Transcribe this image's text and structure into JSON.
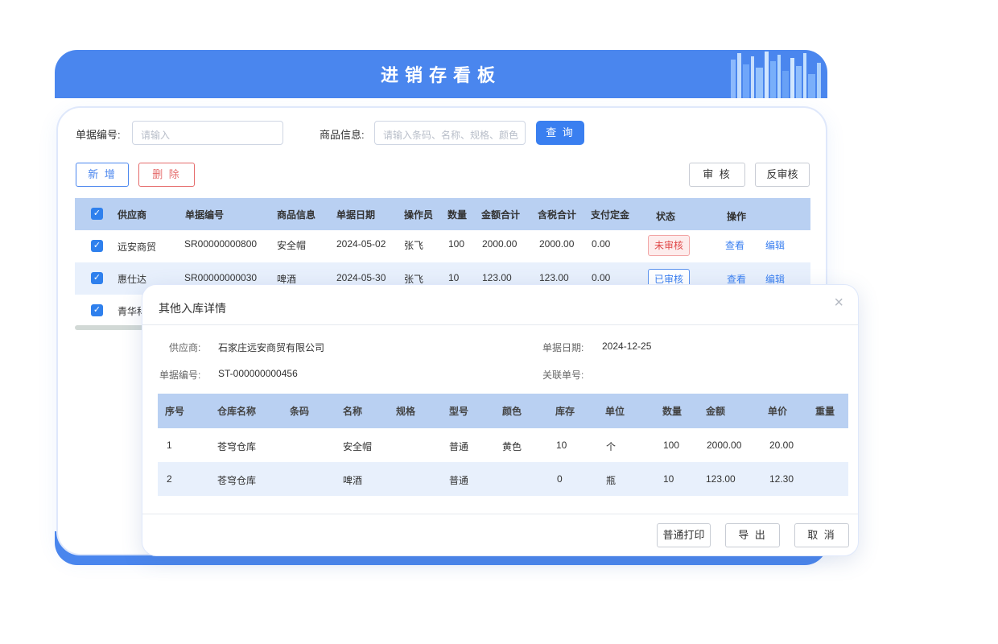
{
  "header": {
    "title": "进销存看板"
  },
  "search": {
    "doc_no_label": "单据编号:",
    "doc_no_placeholder": "请输入",
    "goods_label": "商品信息:",
    "goods_placeholder": "请输入条码、名称、规格、颜色",
    "query_button": "查 询"
  },
  "toolbar": {
    "add_button": "新 增",
    "delete_button": "删 除",
    "audit_button": "审 核",
    "unaudit_button": "反审核"
  },
  "list_table": {
    "headers": [
      "供应商",
      "单据编号",
      "商品信息",
      "单据日期",
      "操作员",
      "数量",
      "金额合计",
      "含税合计",
      "支付定金",
      "状态",
      "操作"
    ],
    "rows": [
      {
        "supplier": "远安商贸",
        "doc_no": "SR00000000800",
        "goods": "安全帽",
        "date": "2024-05-02",
        "operator": "张飞",
        "qty": "100",
        "amount": "2000.00",
        "tax_amount": "2000.00",
        "deposit": "0.00",
        "status": "未审核",
        "view": "查看",
        "edit": "编辑"
      },
      {
        "supplier": "惠仕达",
        "doc_no": "SR00000000030",
        "goods": "啤酒",
        "date": "2024-05-30",
        "operator": "张飞",
        "qty": "10",
        "amount": "123.00",
        "tax_amount": "123.00",
        "deposit": "0.00",
        "status": "已审核",
        "view": "查看",
        "edit": "编辑"
      },
      {
        "supplier": "青华科"
      }
    ]
  },
  "modal": {
    "title": "其他入库详情",
    "supplier_label": "供应商:",
    "supplier_value": "石家庄远安商贸有限公司",
    "date_label": "单据日期:",
    "date_value": "2024-12-25",
    "doc_no_label": "单据编号:",
    "doc_no_value": "ST-000000000456",
    "related_label": "关联单号:",
    "related_value": "",
    "table": {
      "headers": [
        "序号",
        "仓库名称",
        "条码",
        "名称",
        "规格",
        "型号",
        "颜色",
        "库存",
        "单位",
        "数量",
        "金额",
        "单价",
        "重量"
      ],
      "rows": [
        [
          "1",
          "苍穹仓库",
          "",
          "安全帽",
          "",
          "普通",
          "黄色",
          "10",
          "个",
          "100",
          "2000.00",
          "20.00",
          ""
        ],
        [
          "2",
          "苍穹仓库",
          "",
          "啤酒",
          "",
          "普通",
          "",
          "0",
          "瓶",
          "10",
          "123.00",
          "12.30",
          ""
        ]
      ]
    },
    "print_button": "普通打印",
    "export_button": "导 出",
    "cancel_button": "取 消"
  },
  "colors": {
    "primary": "#4a86ee",
    "header_row": "#b9d0f2",
    "alt_row": "#e8f0fc",
    "danger": "#e04a4a"
  }
}
